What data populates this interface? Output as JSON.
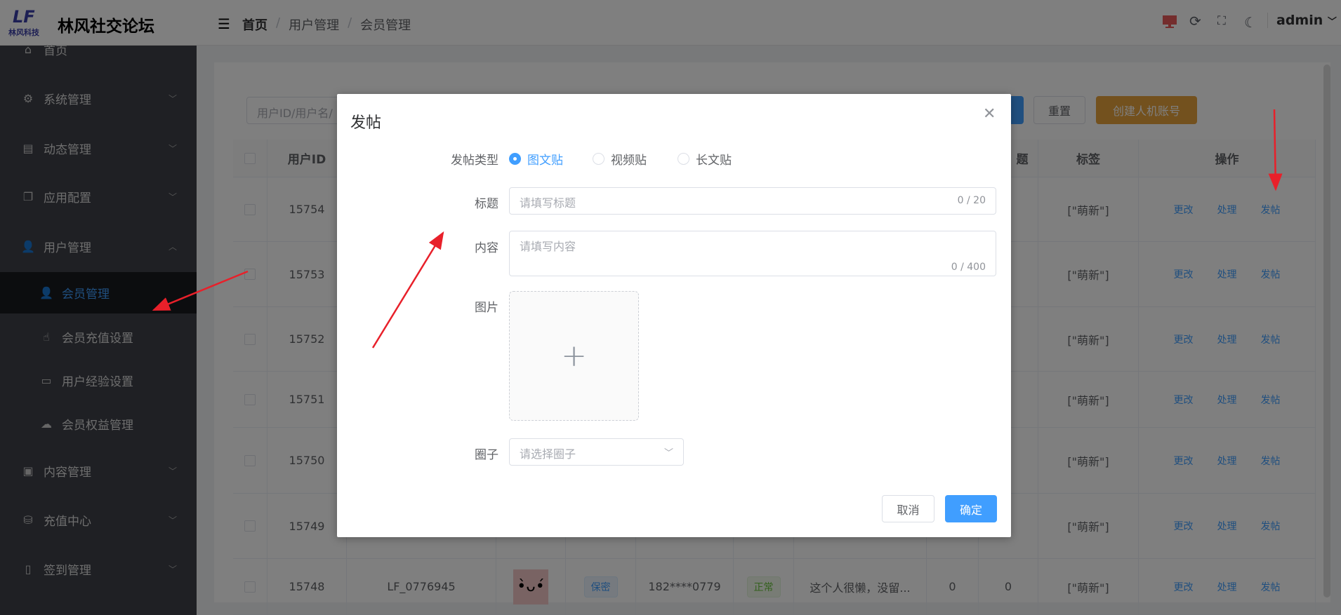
{
  "app": {
    "logo_text": "LF 林风科技",
    "title": "林风社交论坛"
  },
  "breadcrumb": [
    "首页",
    "用户管理",
    "会员管理"
  ],
  "header": {
    "user": "admin",
    "icons": [
      "monitor-icon",
      "refresh-icon",
      "fullscreen-icon",
      "moon-icon"
    ],
    "monitor_color": "#e85a5a"
  },
  "sidebar": {
    "items": [
      {
        "label": "首页",
        "icon": "home-icon",
        "glyph": "⌂"
      },
      {
        "label": "系统管理",
        "icon": "gear-icon",
        "glyph": "⚙",
        "chevron": "down"
      },
      {
        "label": "动态管理",
        "icon": "message-icon",
        "glyph": "▤",
        "chevron": "down"
      },
      {
        "label": "应用配置",
        "icon": "copy-icon",
        "glyph": "❐",
        "chevron": "down"
      },
      {
        "label": "用户管理",
        "icon": "user-icon",
        "glyph": "👤",
        "chevron": "up"
      },
      {
        "label": "会员管理",
        "icon": "user-icon",
        "glyph": "👤",
        "sub": true,
        "active": true
      },
      {
        "label": "会员充值设置",
        "icon": "pointer-icon",
        "glyph": "☝",
        "sub": true
      },
      {
        "label": "用户经验设置",
        "icon": "wallet-icon",
        "glyph": "▭",
        "sub": true
      },
      {
        "label": "会员权益管理",
        "icon": "cloud-icon",
        "glyph": "☁",
        "sub": true
      },
      {
        "label": "内容管理",
        "icon": "postcard-icon",
        "glyph": "▣",
        "chevron": "down"
      },
      {
        "label": "充值中心",
        "icon": "coin-icon",
        "glyph": "⛁",
        "chevron": "down"
      },
      {
        "label": "签到管理",
        "icon": "phone-icon",
        "glyph": "▯",
        "chevron": "down"
      }
    ]
  },
  "toolbar": {
    "search_placeholder": "用户ID/用户名/",
    "reset": "重置",
    "create_bot": "创建人机账号",
    "accent": "#409eff",
    "warning": "#e6a23c"
  },
  "table": {
    "headers": {
      "user_id": "用户ID",
      "partial": "题",
      "tags": "标签",
      "actions": "操作"
    },
    "rows": [
      {
        "id": "15754",
        "tags": "[\"萌新\"]"
      },
      {
        "id": "15753",
        "tags": "[\"萌新\"]"
      },
      {
        "id": "15752",
        "tags": "[\"萌新\"]"
      },
      {
        "id": "15751",
        "tags": "[\"萌新\"]"
      },
      {
        "id": "15750",
        "tags": "[\"萌新\"]"
      },
      {
        "id": "15749",
        "tags": "[\"萌新\"]"
      },
      {
        "id": "15748",
        "username": "LF_0776945",
        "gender": "保密",
        "phone": "182****0779",
        "status": "正常",
        "signature": "这个人很懒，没留...",
        "c1": "0",
        "c2": "0",
        "tags": "[\"萌新\"]"
      }
    ],
    "actions": [
      "更改",
      "处理",
      "发帖"
    ]
  },
  "modal": {
    "title": "发帖",
    "type_label": "发帖类型",
    "types": [
      "图文贴",
      "视频贴",
      "长文贴"
    ],
    "selected_type": "图文贴",
    "title_label": "标题",
    "title_placeholder": "请填写标题",
    "title_count": "0 / 20",
    "content_label": "内容",
    "content_placeholder": "请填写内容",
    "content_count": "0 / 400",
    "image_label": "图片",
    "circle_label": "圈子",
    "circle_placeholder": "请选择圈子",
    "cancel": "取消",
    "confirm": "确定"
  }
}
